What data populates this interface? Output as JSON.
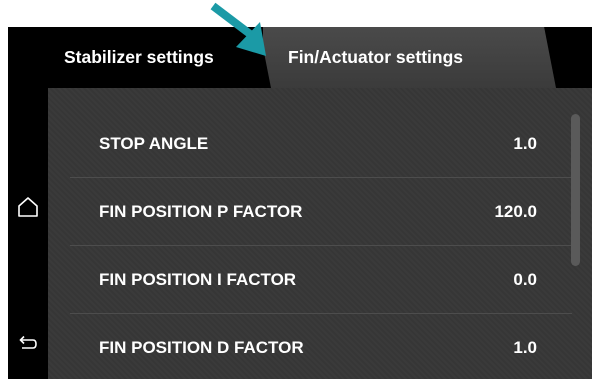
{
  "tabs": [
    {
      "label": "Stabilizer settings",
      "active": false
    },
    {
      "label": "Fin/Actuator settings",
      "active": true
    }
  ],
  "settings": [
    {
      "label": "STOP ANGLE",
      "value": "1.0"
    },
    {
      "label": "FIN POSITION P FACTOR",
      "value": "120.0"
    },
    {
      "label": "FIN POSITION I FACTOR",
      "value": "0.0"
    },
    {
      "label": "FIN POSITION D FACTOR",
      "value": "1.0"
    }
  ],
  "nav": {
    "home_icon": "home-icon",
    "back_icon": "back-arrow-icon"
  },
  "annotation": {
    "icon": "pointer-arrow-icon",
    "color": "#1b9aa6"
  },
  "colors": {
    "screen_bg": "#000000",
    "panel_bg": "#373737",
    "active_tab_bg": "#444444",
    "text": "#ffffff"
  }
}
